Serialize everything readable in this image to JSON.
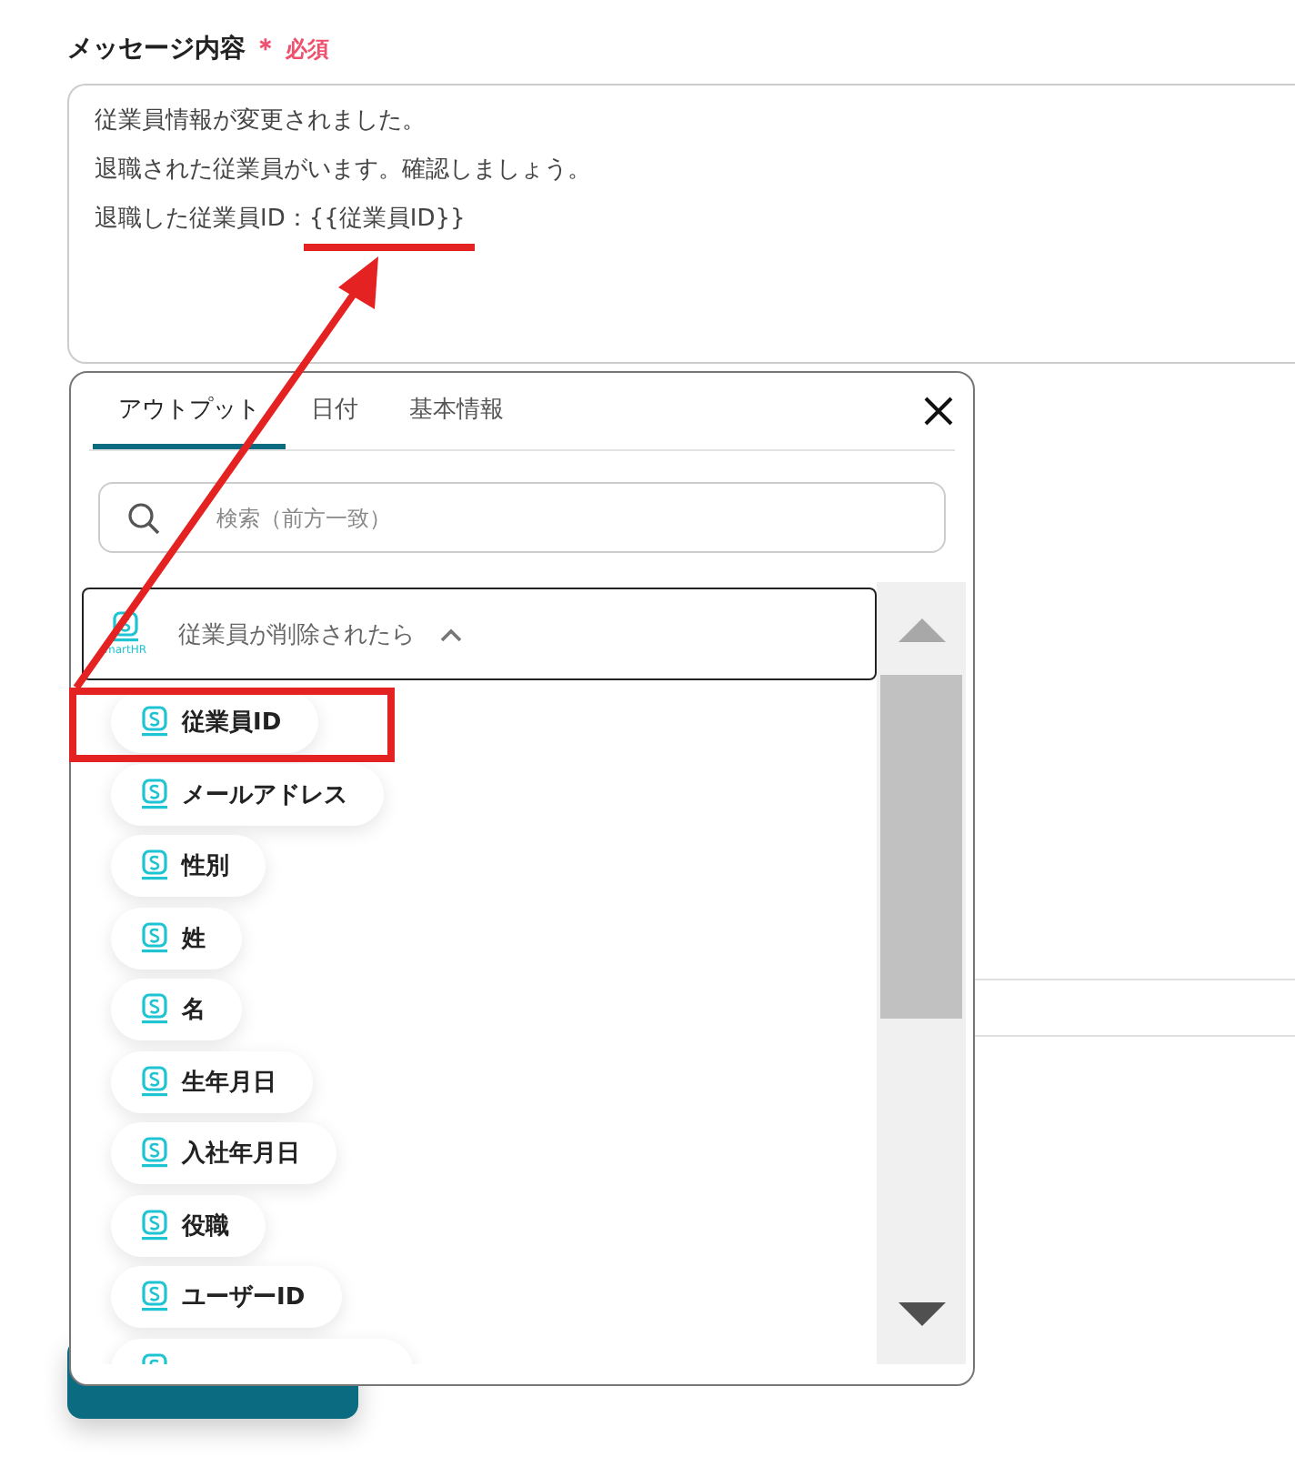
{
  "field": {
    "label": "メッセージ内容",
    "required_mark": "＊",
    "required_text": "必須",
    "lines": [
      "従業員情報が変更されました。",
      "退職された従業員がいます。確認しましょう。",
      "退職した従業員ID：{{従業員ID}}"
    ]
  },
  "popup": {
    "tabs": [
      {
        "label": "アウトプット",
        "selected": true
      },
      {
        "label": "日付",
        "selected": false
      },
      {
        "label": "基本情報",
        "selected": false
      }
    ],
    "search": {
      "placeholder": "検索（前方一致）"
    },
    "group": {
      "title": "従業員が削除されたら",
      "logo_text": "martHR",
      "expanded": true
    },
    "items": [
      {
        "label": "従業員ID"
      },
      {
        "label": "メールアドレス"
      },
      {
        "label": "性別"
      },
      {
        "label": "姓"
      },
      {
        "label": "名"
      },
      {
        "label": "生年月日"
      },
      {
        "label": "入社年月日"
      },
      {
        "label": "役職"
      },
      {
        "label": "ユーザーID"
      }
    ]
  }
}
